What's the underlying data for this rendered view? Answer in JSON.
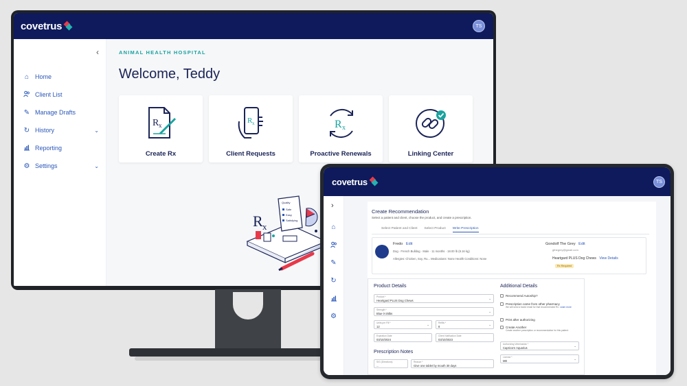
{
  "brand": {
    "name": "covetrus",
    "primary": "#0e1a5c",
    "accent_teal": "#1aa39f",
    "link": "#2b57b8"
  },
  "user": {
    "initials": "TS"
  },
  "desktop": {
    "sidebar": {
      "items": [
        {
          "label": "Home",
          "icon": "home-icon"
        },
        {
          "label": "Client List",
          "icon": "clients-icon"
        },
        {
          "label": "Manage Drafts",
          "icon": "pencil-icon"
        },
        {
          "label": "History",
          "icon": "history-icon"
        },
        {
          "label": "Reporting",
          "icon": "chart-icon"
        },
        {
          "label": "Settings",
          "icon": "gear-icon"
        }
      ]
    },
    "hospital": "ANIMAL HEALTH HOSPITAL",
    "welcome": "Welcome, Teddy",
    "cards": [
      {
        "label": "Create Rx"
      },
      {
        "label": "Client Requests"
      },
      {
        "label": "Proactive Renewals"
      },
      {
        "label": "Linking Center"
      }
    ],
    "illustration": {
      "checklist_title": "Quality",
      "checklist": [
        "Safe",
        "Easy",
        "Satisfying"
      ]
    }
  },
  "tablet": {
    "title": "Create Recommendation",
    "subtitle": "Select a patient and client, choose the product, and create a prescription.",
    "steps": [
      "Select Patient and Client",
      "Select Product",
      "Write Prescription"
    ],
    "patient": {
      "name": "Fredo",
      "edit": "Edit",
      "species": "Dog",
      "breed": "French Bulldog",
      "sex": "Male",
      "age": "11 months",
      "weight": "18.00 lb (8.16 kg)",
      "allergies_label": "Allergies:",
      "allergies": "Chicken, Soy, Ru...",
      "medications_label": "Medications:",
      "medications": "None",
      "conditions_label": "Health Conditions:",
      "conditions": "None"
    },
    "client": {
      "name": "Gondolf The Grey",
      "edit": "Edit",
      "email": "gthegrey@gmail.com"
    },
    "product": {
      "name": "Heartgard PLUS Dog Chews",
      "link": "View Details",
      "badge": "Rx Required"
    },
    "product_details": {
      "title": "Product Details",
      "product": {
        "label": "Product *",
        "value": "Heartgard PLUS Dog Chews"
      },
      "strength": {
        "label": "Strength *",
        "value": "Blue 0-25lbs"
      },
      "units": {
        "label": "Units per Fill *",
        "value": "12"
      },
      "refills": {
        "label": "Refills *",
        "value": "8"
      },
      "expiration": {
        "label": "Expiration Date",
        "value": "03/10/2024"
      },
      "notification": {
        "label": "Client Notification Date",
        "value": "03/10/2023"
      }
    },
    "additional_details": {
      "title": "Additional Details",
      "autoship": "Recommend Autoship?",
      "other_pharmacy": "Prescription came from other pharmacy",
      "other_pharmacy_note": "We will send a faxed email for that recommended Rx.",
      "learn_more": "Learn more",
      "print": "Print after authorizing",
      "create_another": "Create Another",
      "create_another_note": "Create another prescription or recommendation for this patient.",
      "vet_label": "Authorizing Veterinarian *",
      "vet_value": "Capricorn Aquarius",
      "license_label": "License *",
      "license_value": "ME"
    },
    "notes": {
      "title": "Prescription Notes",
      "sig_label": "SIG (Directions)",
      "sig_value": "...",
      "reason_label": "Reason *",
      "reason_value": "Give one tablet by mouth 30 days"
    }
  }
}
